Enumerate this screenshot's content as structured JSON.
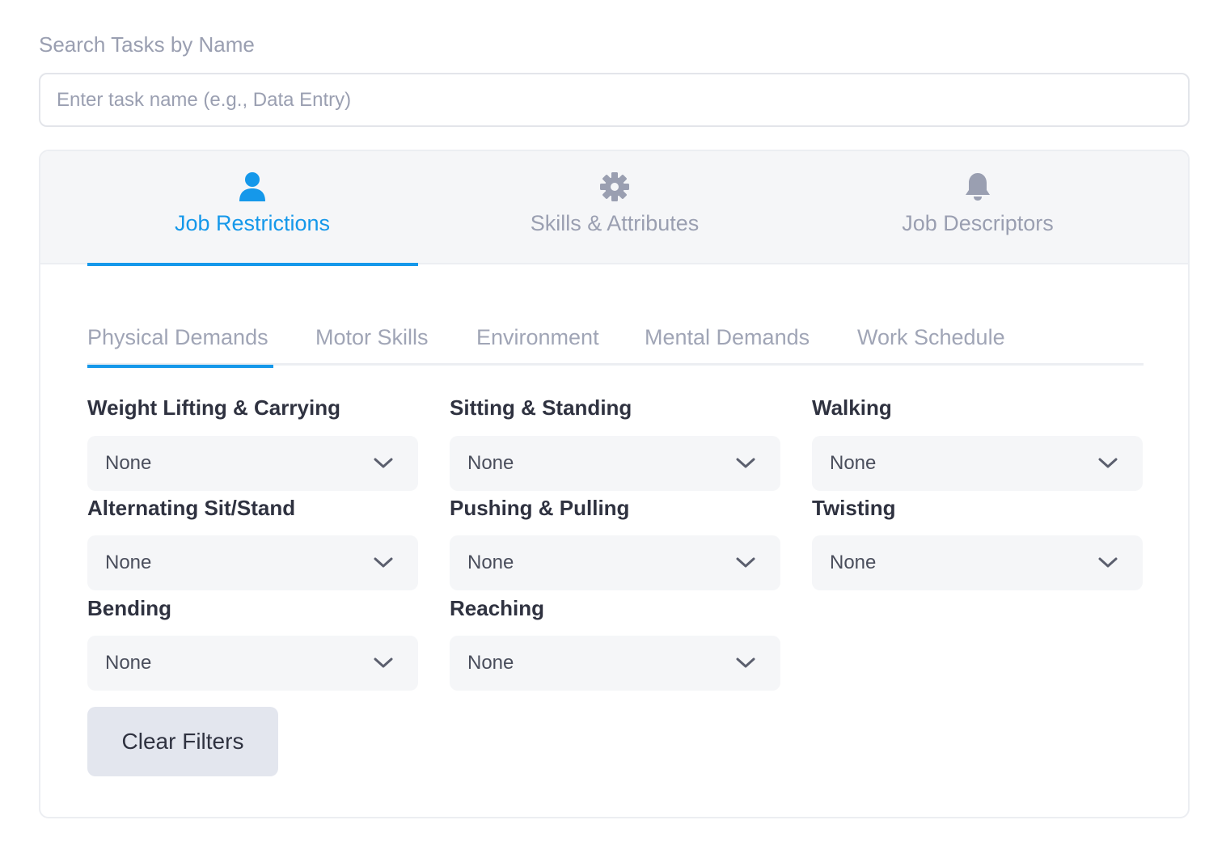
{
  "search": {
    "label": "Search Tasks by Name",
    "placeholder": "Enter task name (e.g., Data Entry)",
    "value": ""
  },
  "top_tabs": [
    {
      "label": "Job Restrictions",
      "icon": "user-icon",
      "active": true
    },
    {
      "label": "Skills & Attributes",
      "icon": "gear-icon",
      "active": false
    },
    {
      "label": "Job Descriptors",
      "icon": "bell-icon",
      "active": false
    }
  ],
  "sub_tabs": [
    {
      "label": "Physical Demands",
      "active": true
    },
    {
      "label": "Motor Skills",
      "active": false
    },
    {
      "label": "Environment",
      "active": false
    },
    {
      "label": "Mental Demands",
      "active": false
    },
    {
      "label": "Work Schedule",
      "active": false
    }
  ],
  "filters": [
    {
      "label": "Weight Lifting & Carrying",
      "value": "None"
    },
    {
      "label": "Sitting & Standing",
      "value": "None"
    },
    {
      "label": "Walking",
      "value": "None"
    },
    {
      "label": "Alternating Sit/Stand",
      "value": "None"
    },
    {
      "label": "Pushing & Pulling",
      "value": "None"
    },
    {
      "label": "Twisting",
      "value": "None"
    },
    {
      "label": "Bending",
      "value": "None"
    },
    {
      "label": "Reaching",
      "value": "None"
    }
  ],
  "clear_button": "Clear Filters",
  "colors": {
    "accent": "#1598ea",
    "muted_text": "#9a9fb1",
    "panel_bg": "#f5f6f8",
    "button_bg": "#e3e6ee"
  }
}
